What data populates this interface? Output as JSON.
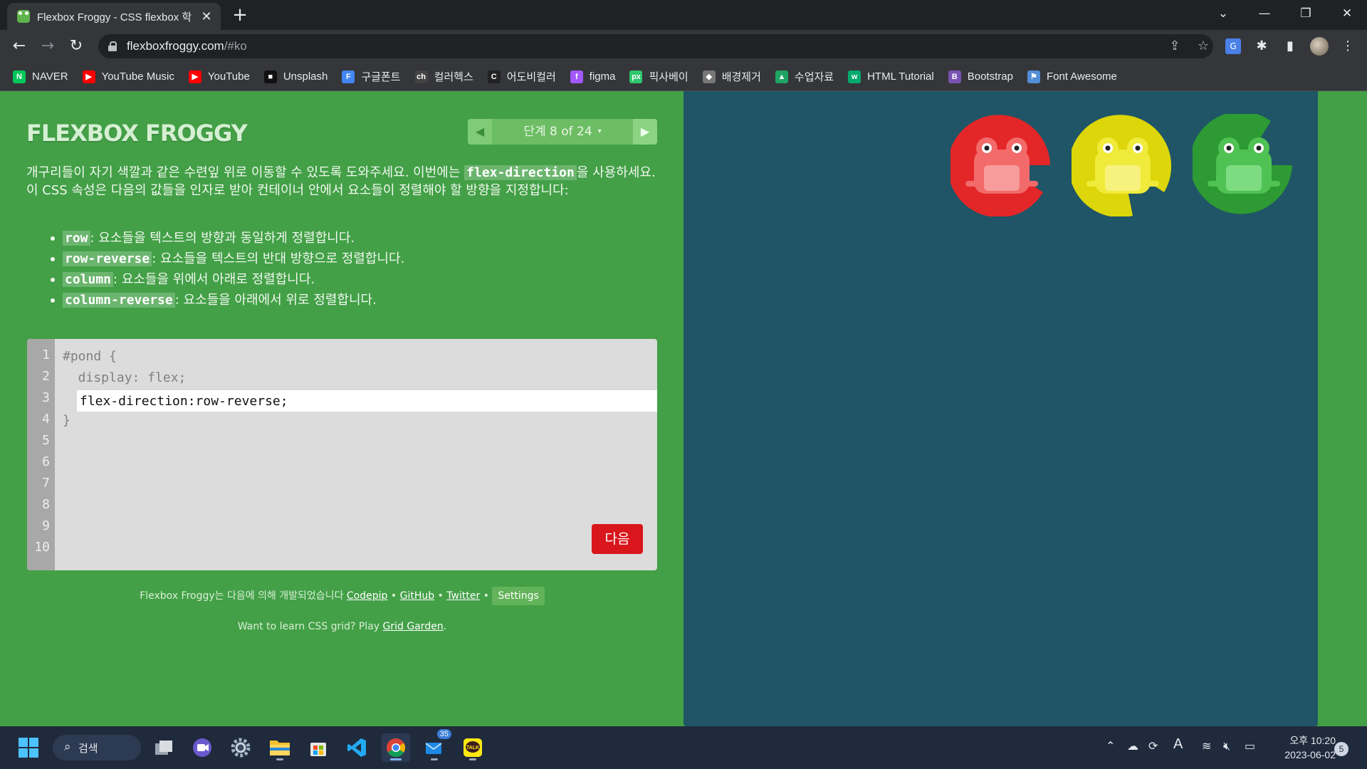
{
  "browser": {
    "tab_title": "Flexbox Froggy - CSS flexbox 학",
    "tab_close": "✕",
    "new_tab": "+",
    "url_host": "flexboxfroggy.com",
    "url_path": "/#ko",
    "icons": [
      "back-icon",
      "forward-icon",
      "reload-icon",
      "lock-icon",
      "share-icon",
      "star-icon",
      "translate-icon",
      "extensions-icon",
      "sidepanel-icon",
      "profile-avatar",
      "menu-icon"
    ]
  },
  "bookmarks": [
    {
      "label": "NAVER",
      "icon": "N",
      "color": "#03c75a"
    },
    {
      "label": "YouTube Music",
      "icon": "▶",
      "color": "#ff0000"
    },
    {
      "label": "YouTube",
      "icon": "▶",
      "color": "#ff0000"
    },
    {
      "label": "Unsplash",
      "icon": "■",
      "color": "#111111"
    },
    {
      "label": "구글폰트",
      "icon": "F",
      "color": "#4285f4"
    },
    {
      "label": "컬러헥스",
      "icon": "ch",
      "color": "#444444"
    },
    {
      "label": "어도비컬러",
      "icon": "C",
      "color": "#222222"
    },
    {
      "label": "figma",
      "icon": "f",
      "color": "#a259ff"
    },
    {
      "label": "픽사베이",
      "icon": "px",
      "color": "#2ec66d"
    },
    {
      "label": "배경제거",
      "icon": "◆",
      "color": "#777777"
    },
    {
      "label": "수업자료",
      "icon": "▲",
      "color": "#1fa463"
    },
    {
      "label": "HTML Tutorial",
      "icon": "w",
      "color": "#04aa6d"
    },
    {
      "label": "Bootstrap",
      "icon": "B",
      "color": "#7952b3"
    },
    {
      "label": "Font Awesome",
      "icon": "⚑",
      "color": "#528dd7"
    }
  ],
  "game": {
    "title": "FLEXBOX FROGGY",
    "level_label": "단계 8 of 24",
    "level_caret": "▾",
    "prev_arrow": "◀",
    "next_arrow": "▶",
    "instructions": {
      "before": "개구리들이 자기 색깔과 같은 수련잎 위로 이동할 수 있도록 도와주세요. 이번에는 ",
      "keyword": "flex-direction",
      "after": "을 사용하세요. 이 CSS 속성은 다음의 값들을 인자로 받아 컨테이너 안에서 요소들이 정렬해야 할 방향을 지정합니다:"
    },
    "bullets": [
      {
        "code": "row",
        "text": ": 요소들을 텍스트의 방향과 동일하게 정렬합니다."
      },
      {
        "code": "row-reverse",
        "text": ": 요소들을 텍스트의 반대 방향으로 정렬합니다."
      },
      {
        "code": "column",
        "text": ": 요소들을 위에서 아래로 정렬합니다."
      },
      {
        "code": "column-reverse",
        "text": ": 요소들을 아래에서 위로 정렬합니다."
      }
    ],
    "editor": {
      "line_numbers": [
        "1",
        "2",
        "3",
        "4",
        "5",
        "6",
        "7",
        "8",
        "9",
        "10"
      ],
      "line1": "#pond {",
      "line2": "  display: flex;",
      "input_value": "flex-direction:row-reverse;",
      "line4": "}"
    },
    "next_button": "다음",
    "credits": {
      "prefix": "Flexbox Froggy는 다음에 의해 개발되었습니다 ",
      "codepip": "Codepip",
      "sep": " • ",
      "github": "GitHub",
      "twitter": "Twitter",
      "settings": "Settings"
    },
    "promo": {
      "prefix": "Want to learn CSS grid? Play ",
      "link": "Grid Garden",
      "suffix": "."
    },
    "pond": {
      "lilypads": [
        "red",
        "yellow",
        "green"
      ],
      "frogs": [
        "red",
        "yellow",
        "green"
      ],
      "colors": {
        "red": "#e32628",
        "yellow": "#dcd60a",
        "green": "#2d9a34",
        "pond": "#1f5566"
      }
    }
  },
  "taskbar": {
    "search_label": "검색",
    "apps": [
      "windows-start-icon",
      "task-view-icon",
      "chat-icon",
      "settings-icon",
      "file-explorer-icon",
      "store-icon",
      "vscode-icon",
      "chrome-icon",
      "mail-icon",
      "kakaotalk-icon"
    ],
    "mail_badge": "35",
    "ime_label": "A",
    "clock_time": "오후 10:20",
    "clock_date": "2023-06-02",
    "notification_count": "5"
  }
}
